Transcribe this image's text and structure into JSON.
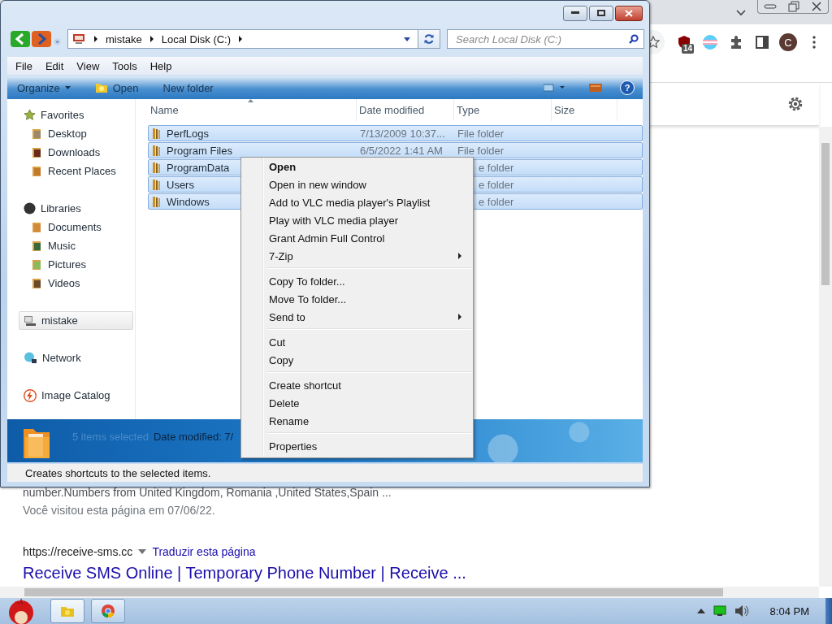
{
  "browser": {
    "badge": "14",
    "avatar": "C",
    "results": [
      {
        "kind": "snippet",
        "text": "number.Numbers from United Kingdom, Romania ,United States,Spain ..."
      },
      {
        "kind": "visited",
        "text": "Você visitou esta página em 07/06/22."
      },
      {
        "kind": "url",
        "text": "https://receive-sms.cc",
        "link": "Traduzir esta página"
      },
      {
        "kind": "title",
        "text": "Receive SMS Online | Temporary Phone Number | Receive ..."
      }
    ]
  },
  "explorer": {
    "crumbs": [
      "mistake",
      "Local Disk (C:)"
    ],
    "search": {
      "placeholder": "Search Local Disk (C:)"
    },
    "menu": [
      "File",
      "Edit",
      "View",
      "Tools",
      "Help"
    ],
    "toolbar": [
      {
        "label": "Organize",
        "kind": "dropdown"
      },
      {
        "label": "Open",
        "kind": "icon"
      },
      {
        "label": "New folder",
        "kind": "plain"
      }
    ],
    "help": "?",
    "sidebar": [
      {
        "label": "Favorites",
        "selected": false,
        "children": [
          {
            "label": "Desktop",
            "selected": false
          },
          {
            "label": "Downloads",
            "selected": false
          },
          {
            "label": "Recent Places",
            "selected": false
          }
        ]
      },
      {
        "label": "Libraries",
        "selected": false,
        "children": [
          {
            "label": "Documents",
            "selected": false
          },
          {
            "label": "Music",
            "selected": false
          },
          {
            "label": "Pictures",
            "selected": false
          },
          {
            "label": "Videos",
            "selected": false
          }
        ]
      },
      {
        "label": "mistake",
        "selected": true
      },
      {
        "label": "Network",
        "selected": false
      },
      {
        "label": "Image Catalog",
        "selected": false
      }
    ],
    "columns": [
      "Name",
      "Date modified",
      "Type",
      "Size"
    ],
    "files": [
      {
        "name": "PerfLogs",
        "date": "7/13/2009 10:37...",
        "type": "File folder",
        "selected": true
      },
      {
        "name": "Program Files",
        "date": "6/5/2022 1:41 AM",
        "type": "File folder",
        "selected": true
      },
      {
        "name": "ProgramData",
        "type": "e folder",
        "selected": true
      },
      {
        "name": "Users",
        "type": "e folder",
        "selected": true
      },
      {
        "name": "Windows",
        "type": "e folder",
        "selected": true
      }
    ],
    "details": {
      "selection": "5 items selected",
      "date": "Date modified: 7/"
    },
    "status": "Creates shortcuts to the selected items."
  },
  "context_menu": [
    [
      {
        "label": "Open",
        "default": true,
        "submenu": false
      },
      {
        "label": "Open in new window",
        "default": false,
        "submenu": false
      },
      {
        "label": "Add to VLC media player's Playlist",
        "default": false,
        "submenu": false
      },
      {
        "label": "Play with VLC media player",
        "default": false,
        "submenu": false
      },
      {
        "label": "Grant Admin Full Control",
        "default": false,
        "submenu": false
      },
      {
        "label": "7-Zip",
        "default": false,
        "submenu": true
      }
    ],
    [
      {
        "label": "Copy To folder...",
        "default": false,
        "submenu": false
      },
      {
        "label": "Move To folder...",
        "default": false,
        "submenu": false
      },
      {
        "label": "Send to",
        "default": false,
        "submenu": true
      }
    ],
    [
      {
        "label": "Cut",
        "default": false,
        "submenu": false
      },
      {
        "label": "Copy",
        "default": false,
        "submenu": false
      }
    ],
    [
      {
        "label": "Create shortcut",
        "default": false,
        "submenu": false
      },
      {
        "label": "Delete",
        "default": false,
        "submenu": false
      },
      {
        "label": "Rename",
        "default": false,
        "submenu": false
      }
    ],
    [
      {
        "label": "Properties",
        "default": false,
        "submenu": false
      }
    ]
  ],
  "taskbar": {
    "clock": "8:04 PM"
  }
}
